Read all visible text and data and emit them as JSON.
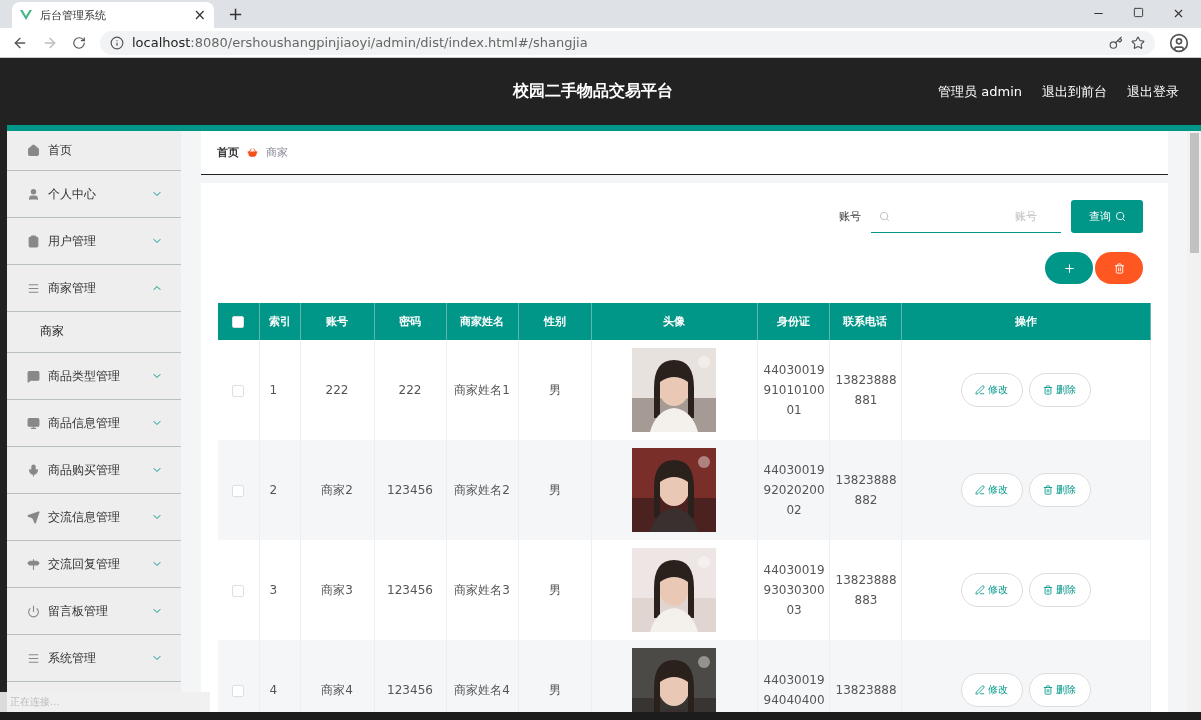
{
  "browser": {
    "tab_title": "后台管理系统",
    "tab_close": "×",
    "new_tab": "+",
    "url_host": "localhost",
    "url_rest": ":8080/ershoushangpinjiaoyi/admin/dist/index.html#/shangjia"
  },
  "header": {
    "title": "校园二手物品交易平台",
    "user_label": "管理员 admin",
    "links": [
      "退出到前台",
      "退出登录"
    ]
  },
  "sidebar": {
    "items": [
      {
        "label": "首页",
        "kind": "link"
      },
      {
        "label": "个人中心",
        "kind": "menu",
        "expanded": false
      },
      {
        "label": "用户管理",
        "kind": "menu",
        "expanded": false
      },
      {
        "label": "商家管理",
        "kind": "menu",
        "expanded": true,
        "children": [
          {
            "label": "商家"
          }
        ]
      },
      {
        "label": "商品类型管理",
        "kind": "menu",
        "expanded": false
      },
      {
        "label": "商品信息管理",
        "kind": "menu",
        "expanded": false
      },
      {
        "label": "商品购买管理",
        "kind": "menu",
        "expanded": false
      },
      {
        "label": "交流信息管理",
        "kind": "menu",
        "expanded": false
      },
      {
        "label": "交流回复管理",
        "kind": "menu",
        "expanded": false
      },
      {
        "label": "留言板管理",
        "kind": "menu",
        "expanded": false
      },
      {
        "label": "系统管理",
        "kind": "menu",
        "expanded": false
      }
    ]
  },
  "breadcrumb": [
    "首页",
    "商家"
  ],
  "search": {
    "label": "账号",
    "placeholder": "账号",
    "button": "查询"
  },
  "table": {
    "select_all": false,
    "columns": [
      "索引",
      "账号",
      "密码",
      "商家姓名",
      "性别",
      "头像",
      "身份证",
      "联系电话",
      "操作"
    ],
    "rows": [
      {
        "checked": false,
        "cells": [
          "1",
          "222",
          "222",
          "商家姓名1",
          "男"
        ],
        "id_card": "440300199101010001",
        "phone": "13823888881",
        "actions": [
          "修改",
          "删除"
        ]
      },
      {
        "checked": false,
        "cells": [
          "2",
          "商家2",
          "123456",
          "商家姓名2",
          "男"
        ],
        "id_card": "440300199202020002",
        "phone": "13823888882",
        "actions": [
          "修改",
          "删除"
        ]
      },
      {
        "checked": false,
        "cells": [
          "3",
          "商家3",
          "123456",
          "商家姓名3",
          "男"
        ],
        "id_card": "440300199303030003",
        "phone": "13823888883",
        "actions": [
          "修改",
          "删除"
        ]
      },
      {
        "checked": false,
        "cells": [
          "4",
          "商家4",
          "123456",
          "商家姓名4",
          "男"
        ],
        "id_card": "4403001994040400",
        "phone": "13823888",
        "actions": [
          "修改",
          "删除"
        ]
      }
    ]
  },
  "status_text": "正在连接..."
}
